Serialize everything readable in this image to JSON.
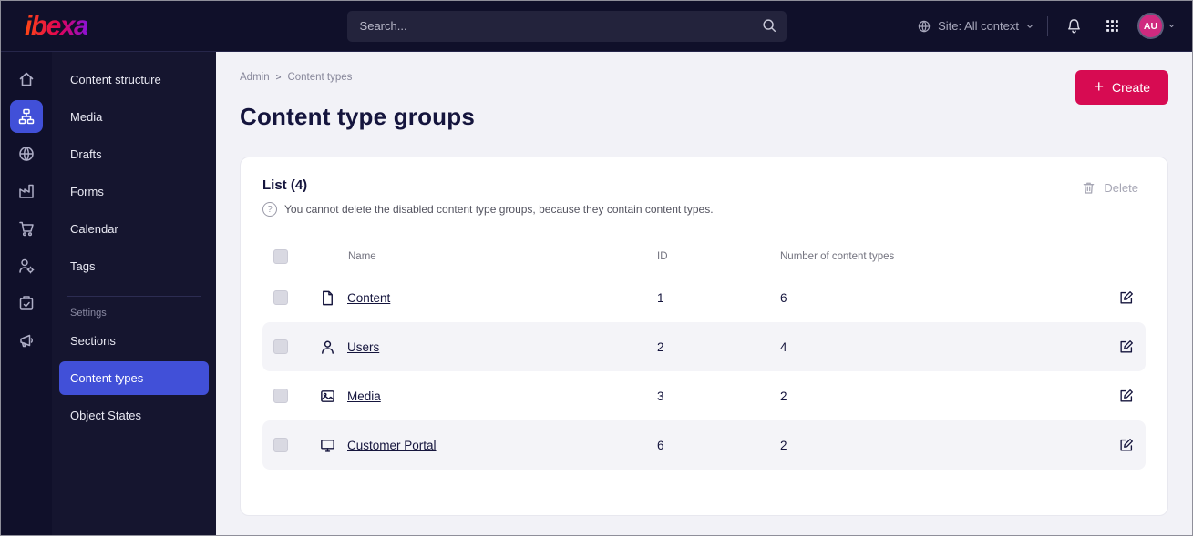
{
  "topbar": {
    "logo": "ibexa",
    "search": {
      "placeholder": "Search..."
    },
    "site_context": "Site: All context",
    "avatar_initials": "AU"
  },
  "icon_rail": {
    "items": [
      "home-icon",
      "content-structure-icon",
      "site-search-icon",
      "product-catalog-icon",
      "commerce-icon",
      "admin-icon",
      "activity-icon",
      "marketing-icon"
    ],
    "active_index": 1
  },
  "sidebar": {
    "items": [
      "Content structure",
      "Media",
      "Drafts",
      "Forms",
      "Calendar",
      "Tags"
    ],
    "settings_label": "Settings",
    "settings_items": [
      "Sections",
      "Content types",
      "Object States"
    ],
    "active_item": "Content types"
  },
  "main": {
    "breadcrumb": {
      "parent": "Admin",
      "sep": ">",
      "current": "Content types"
    },
    "create_button": {
      "plus": "+",
      "label": "Create"
    },
    "page_title": "Content type groups",
    "list": {
      "title": "List (4)",
      "help_glyph": "?",
      "info": "You cannot delete the disabled content type groups, because they contain content types.",
      "delete_label": "Delete",
      "columns": {
        "name": "Name",
        "id": "ID",
        "count": "Number of content types"
      },
      "rows": [
        {
          "icon": "content-file-icon",
          "name": "Content",
          "id": "1",
          "count": "6"
        },
        {
          "icon": "users-icon",
          "name": "Users",
          "id": "2",
          "count": "4"
        },
        {
          "icon": "media-image-icon",
          "name": "Media",
          "id": "3",
          "count": "2"
        },
        {
          "icon": "customer-portal-monitor-icon",
          "name": "Customer Portal",
          "id": "6",
          "count": "2"
        }
      ]
    }
  },
  "colors": {
    "accent_pink": "#d70b52",
    "accent_blue": "#4150d8",
    "chrome_dark": "#10102a"
  }
}
